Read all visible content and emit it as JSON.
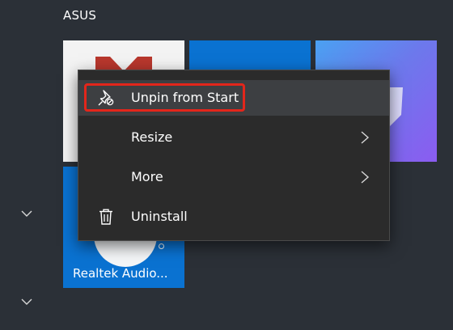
{
  "group": {
    "title": "ASUS"
  },
  "tiles": {
    "realtek_label": "Realtek Audio..."
  },
  "context_menu": {
    "items": [
      {
        "label": "Unpin from Start",
        "icon": "unpin-icon",
        "highlighted": true
      },
      {
        "label": "Resize",
        "icon": null,
        "has_submenu": true
      },
      {
        "label": "More",
        "icon": null,
        "has_submenu": true
      },
      {
        "label": "Uninstall",
        "icon": "trash-icon"
      }
    ]
  },
  "colors": {
    "background": "#2b3037",
    "menu_bg": "#2b2b2b",
    "menu_hover": "#3d3f42",
    "highlight": "#e3261b",
    "tile_blue": "#0a72d1"
  },
  "icons": [
    "chevron-down-icon",
    "chevron-right-icon",
    "unpin-icon",
    "trash-icon"
  ]
}
